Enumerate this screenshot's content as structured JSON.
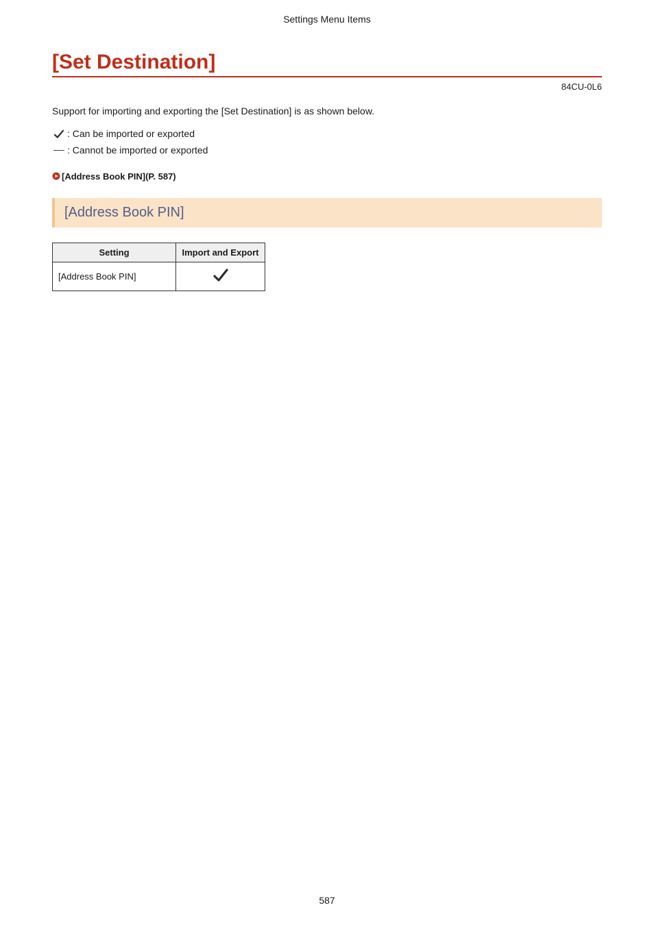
{
  "header": {
    "breadcrumb": "Settings Menu Items"
  },
  "title": "[Set Destination]",
  "doc_id": "84CU-0L6",
  "intro": "Support for importing and exporting the [Set Destination] is as shown below.",
  "legend": {
    "can": ": Can be imported or exported",
    "cannot": " : Cannot be imported or exported"
  },
  "xref": {
    "label": "[Address Book PIN](P. 587)"
  },
  "section": {
    "heading": "[Address Book PIN]"
  },
  "table": {
    "headers": {
      "setting": "Setting",
      "import_export": "Import and Export"
    },
    "rows": [
      {
        "setting": "[Address Book PIN]",
        "import_export": "check"
      }
    ]
  },
  "page_number": "587"
}
